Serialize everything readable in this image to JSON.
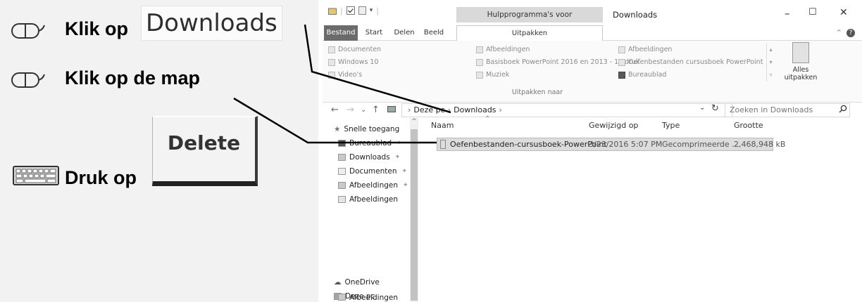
{
  "instructions": {
    "step1_text": "Klik op",
    "step1_word": "Downloads",
    "step2_text": "Klik op de map",
    "step3_text": "Druk op",
    "delete_key": "Delete"
  },
  "window": {
    "contextual_tab": "Hulpprogramma's voor gecomprimeerde mappen",
    "title": "Downloads",
    "min": "–",
    "max": "☐",
    "close": "✕",
    "tabs": [
      "Bestand",
      "Start",
      "Delen",
      "Beeld",
      "Uitpakken"
    ]
  },
  "ribbon": {
    "gallery": [
      "Documenten",
      "Afbeeldingen",
      "Afbeeldingen",
      "Windows 10",
      "Basisboek PowerPoint 2016 en 2013 - 1e druk",
      "Oefenbestanden cursusboek PowerPoint",
      "Video's",
      "Muziek",
      "Bureaublad"
    ],
    "group_label": "Uitpakken naar",
    "extract_all": "Alles uitpakken"
  },
  "address": {
    "crumbs": [
      "Deze pc",
      "Downloads"
    ],
    "search_placeholder": "Zoeken in Downloads"
  },
  "nav_pane": {
    "items": [
      "Snelle toegang",
      "Bureaublad",
      "Downloads",
      "Documenten",
      "Afbeeldingen",
      "Afbeeldingen",
      "OneDrive",
      "Deze pc",
      "Afbeeldingen"
    ]
  },
  "file_list": {
    "columns": [
      "Naam",
      "Gewijzigd op",
      "Type",
      "Grootte"
    ],
    "rows": [
      {
        "name": "Oefenbestanden-cursusboek-PowerPoint",
        "modified": "3/23/2016 5:07 PM",
        "type": "Gecomprimeerde ...",
        "size": "2,468,948 kB"
      }
    ]
  },
  "icons": [
    "mouse-icon",
    "keyboard-icon",
    "search-icon",
    "refresh-icon",
    "zip-folder-icon"
  ]
}
